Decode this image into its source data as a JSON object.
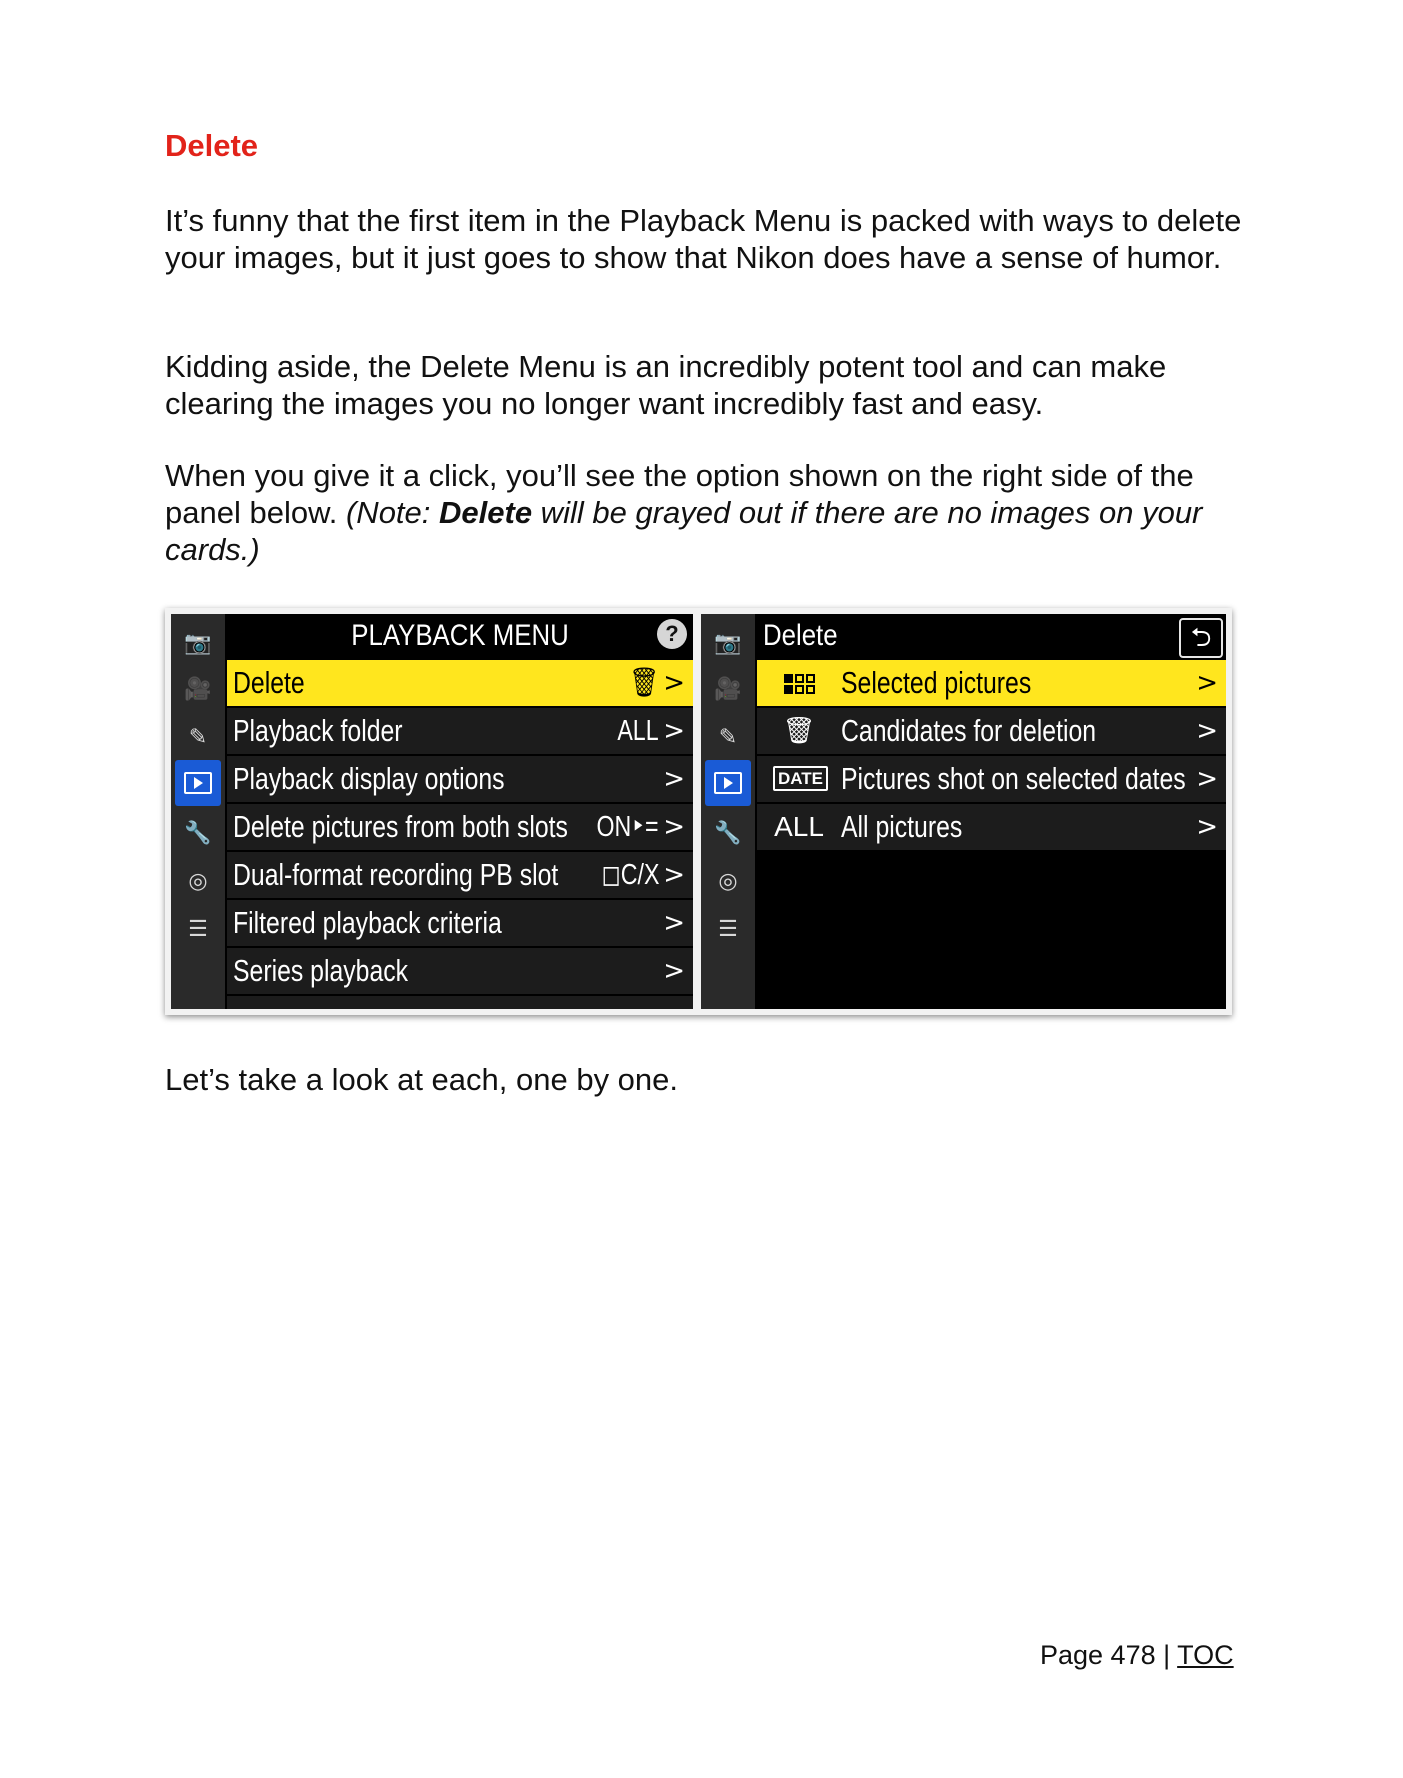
{
  "heading": "Delete",
  "paragraphs": {
    "p1": "It’s funny that the first item in the Playback Menu is packed with ways to delete your images, but it just goes to show that Nikon does have a sense of humor.",
    "p2": "Kidding aside, the Delete Menu is an incredibly potent tool and can make clearing the images you no longer want incredibly fast and easy.",
    "p3_plain": "When you give it a click, you’ll see the option shown on the right side of the panel below. ",
    "p3_note_pre": "(Note: ",
    "p3_note_bold": "Delete",
    "p3_note_post": " will be grayed out if there are no images on your cards.)",
    "p4": "Let’s take a look at each, one by one."
  },
  "left_panel": {
    "title": "PLAYBACK MENU",
    "help": "?",
    "rail_icons": [
      "camera-icon",
      "movie-icon",
      "pencil-icon",
      "playback-icon",
      "wrench-icon",
      "network-icon",
      "my-menu-icon"
    ],
    "items": [
      {
        "label": "Delete",
        "value": "🗑",
        "chevron": ">"
      },
      {
        "label": "Playback folder",
        "value": "ALL",
        "chevron": ">"
      },
      {
        "label": "Playback display options",
        "value": "",
        "chevron": ">"
      },
      {
        "label": "Delete pictures from both slots",
        "value": "ON‣=",
        "chevron": ">"
      },
      {
        "label": "Dual-format recording PB slot",
        "value": "◻C/X",
        "chevron": ">"
      },
      {
        "label": "Filtered playback criteria",
        "value": "",
        "chevron": ">"
      },
      {
        "label": "Series playback",
        "value": "",
        "chevron": ">"
      }
    ],
    "selected_index": 0
  },
  "right_panel": {
    "title": "Delete",
    "back": "⮌",
    "items": [
      {
        "icon": "grid-icon",
        "label": "Selected pictures",
        "chevron": ">"
      },
      {
        "icon": "trash-star-icon",
        "icon_glyph": "🗑",
        "label": "Candidates for deletion",
        "chevron": ">"
      },
      {
        "icon": "date-icon",
        "icon_text": "DATE",
        "label": "Pictures shot on selected dates",
        "chevron": ">"
      },
      {
        "icon": "all-icon",
        "icon_text": "ALL",
        "label": "All pictures",
        "chevron": ">"
      }
    ],
    "selected_index": 0
  },
  "colors": {
    "heading": "#e2231a",
    "highlight": "#ffe61e",
    "active_rail": "#1a5bd6"
  },
  "footer": {
    "page": "Page 478 |",
    "toc": "TOC"
  }
}
